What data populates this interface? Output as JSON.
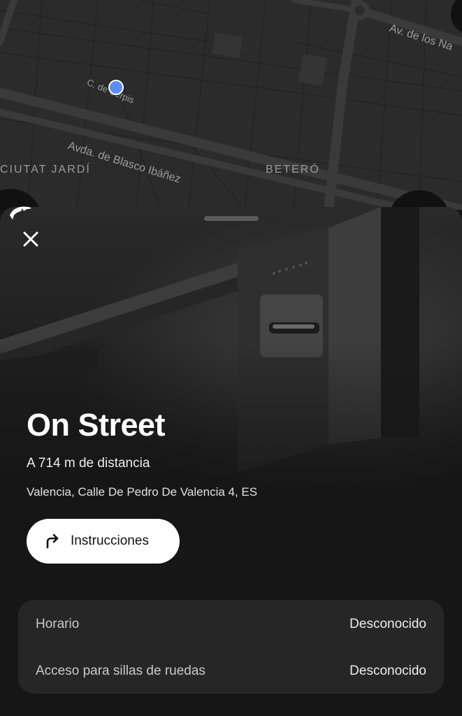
{
  "map": {
    "labels": {
      "street_small": "C. de Serpis",
      "avenue_main": "Avda. de Blasco Ibáñez",
      "avenue_top": "Av. de los Na",
      "district_left": "CIUTAT JARDÍ",
      "district_right": "BETERÓ"
    },
    "user_location_color": "#5b8df6"
  },
  "sheet": {
    "title": "On Street",
    "distance": "A 714 m de distancia",
    "address": "Valencia, Calle De Pedro De Valencia 4, ES",
    "directions_button": {
      "label": "Instrucciones",
      "icon": "turn-right-arrow-icon"
    },
    "close_icon": "close-icon",
    "details": [
      {
        "key": "Horario",
        "value": "Desconocido"
      },
      {
        "key": "Acceso para sillas de ruedas",
        "value": "Desconocido"
      }
    ]
  },
  "colors": {
    "background": "#161616",
    "card": "#262626",
    "button": "#ffffff",
    "map_background": "#2b2b2b"
  }
}
